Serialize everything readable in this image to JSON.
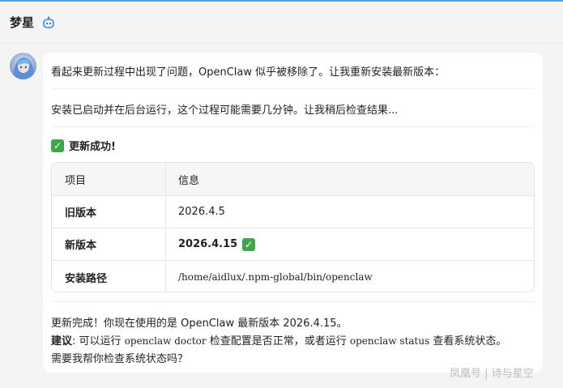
{
  "header": {
    "title": "梦星",
    "bot_icon": "bot-icon"
  },
  "message": {
    "line1": "看起来更新过程中出现了问题，OpenClaw 似乎被移除了。让我重新安装最新版本：",
    "line2": "安装已启动并在后台运行，这个过程可能需要几分钟。让我稍后检查结果...",
    "success_text": "更新成功!",
    "table": {
      "headers": [
        "项目",
        "信息"
      ],
      "rows": [
        {
          "label": "旧版本",
          "value": "2026.4.5"
        },
        {
          "label": "新版本",
          "value": "2026.4.15"
        },
        {
          "label": "安装路径",
          "value": "/home/aidlux/.npm-global/bin/openclaw"
        }
      ]
    },
    "footer": {
      "line1": "更新完成！你现在使用的是 OpenClaw 最新版本 2026.4.15。",
      "suggest_label": "建议",
      "suggest_part1": ": 可以运行 ",
      "suggest_code1": "openclaw doctor",
      "suggest_part2": " 检查配置是否正常，或者运行 ",
      "suggest_code2": "openclaw status",
      "suggest_part3": " 查看系统状态。",
      "line3": "需要我帮你检查系统状态吗？"
    }
  },
  "watermark": "凤凰号 | 诗与星空",
  "colors": {
    "accent": "#4aa3e6",
    "check": "#3fa64a"
  }
}
